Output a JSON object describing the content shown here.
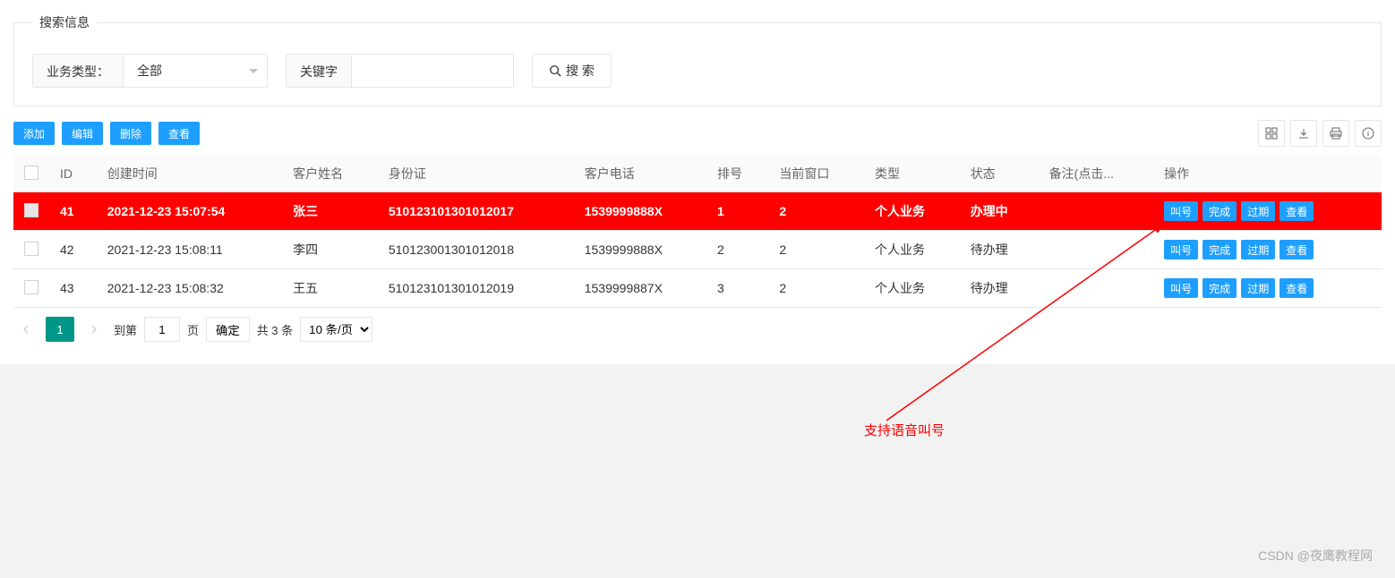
{
  "search": {
    "legend": "搜索信息",
    "business_type_label": "业务类型：",
    "business_type_value": "全部",
    "keyword_label": "关键字",
    "search_button": "搜 索"
  },
  "toolbar": {
    "add": "添加",
    "edit": "编辑",
    "delete": "删除",
    "view": "查看"
  },
  "table": {
    "headers": {
      "id": "ID",
      "create_time": "创建时间",
      "customer_name": "客户姓名",
      "id_card": "身份证",
      "phone": "客户电话",
      "queue_num": "排号",
      "window": "当前窗口",
      "type": "类型",
      "status": "状态",
      "remarks": "备注(点击...",
      "actions": "操作"
    },
    "rows": [
      {
        "id": "41",
        "create_time": "2021-12-23 15:07:54",
        "customer_name": "张三",
        "id_card": "510123101301012017",
        "phone": "1539999888X",
        "queue_num": "1",
        "window": "2",
        "type": "个人业务",
        "status": "办理中",
        "highlighted": true
      },
      {
        "id": "42",
        "create_time": "2021-12-23 15:08:11",
        "customer_name": "李四",
        "id_card": "510123001301012018",
        "phone": "1539999888X",
        "queue_num": "2",
        "window": "2",
        "type": "个人业务",
        "status": "待办理",
        "highlighted": false
      },
      {
        "id": "43",
        "create_time": "2021-12-23 15:08:32",
        "customer_name": "王五",
        "id_card": "510123101301012019",
        "phone": "1539999887X",
        "queue_num": "3",
        "window": "2",
        "type": "个人业务",
        "status": "待办理",
        "highlighted": false
      }
    ],
    "row_actions": {
      "call": "叫号",
      "complete": "完成",
      "expire": "过期",
      "view": "查看"
    }
  },
  "pagination": {
    "goto_label": "到第",
    "page_label": "页",
    "confirm": "确定",
    "total": "共 3 条",
    "per_page": "10 条/页",
    "current_page": "1"
  },
  "annotation": {
    "text": "支持语音叫号"
  },
  "watermark": "CSDN @夜鹰教程网"
}
